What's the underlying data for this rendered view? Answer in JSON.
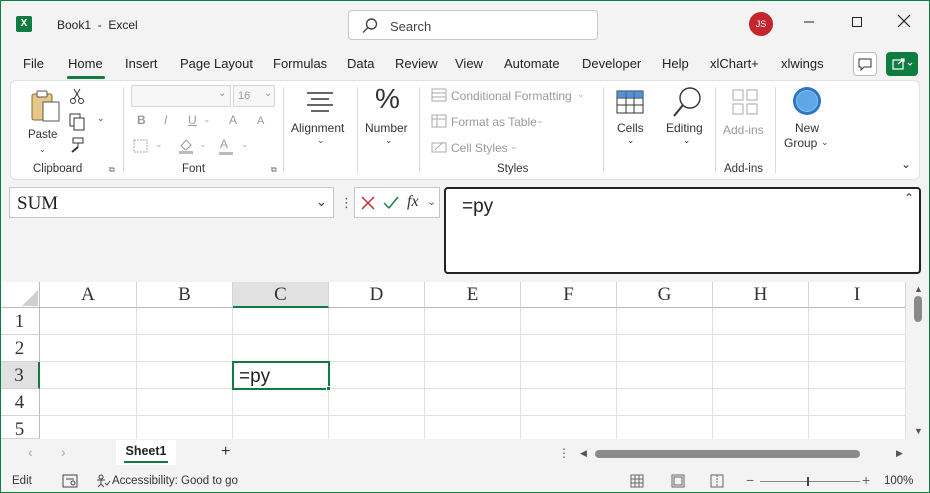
{
  "window": {
    "app_icon_glyph": "X",
    "title": "Book1  -  Excel",
    "search_placeholder": "Search",
    "user_initials": "JS"
  },
  "tabs": [
    "File",
    "Home",
    "Insert",
    "Page Layout",
    "Formulas",
    "Data",
    "Review",
    "View",
    "Automate",
    "Developer",
    "Help",
    "xlChart+",
    "xlwings"
  ],
  "ribbon": {
    "clipboard": {
      "paste": "Paste",
      "label": "Clipboard"
    },
    "font": {
      "size": "16",
      "bold": "B",
      "italic": "I",
      "underline": "U",
      "grow": "A",
      "shrink": "A",
      "font_color": "A",
      "label": "Font"
    },
    "alignment": "Alignment",
    "number": "Number",
    "number_glyph": "%",
    "styles": {
      "conditional": "Conditional Formatting",
      "format_table": "Format as Table",
      "cell_styles": "Cell Styles",
      "label": "Styles"
    },
    "cells": "Cells",
    "editing": "Editing",
    "addins": {
      "button": "Add-ins",
      "label": "Add-ins"
    },
    "newgroup": {
      "line1": "New",
      "line2": "Group"
    }
  },
  "formula_bar": {
    "name_box": "SUM",
    "fx": "fx",
    "content": "=py"
  },
  "grid": {
    "columns": [
      "A",
      "B",
      "C",
      "D",
      "E",
      "F",
      "G",
      "H",
      "I"
    ],
    "rows": [
      "1",
      "2",
      "3",
      "4",
      "5"
    ],
    "active_cell_text": "=py"
  },
  "sheets": [
    "Sheet1"
  ],
  "status": {
    "mode": "Edit",
    "accessibility": "Accessibility: Good to go",
    "zoom": "100%"
  },
  "colors": {
    "accent": "#107c41",
    "avatar": "#c4262e"
  }
}
